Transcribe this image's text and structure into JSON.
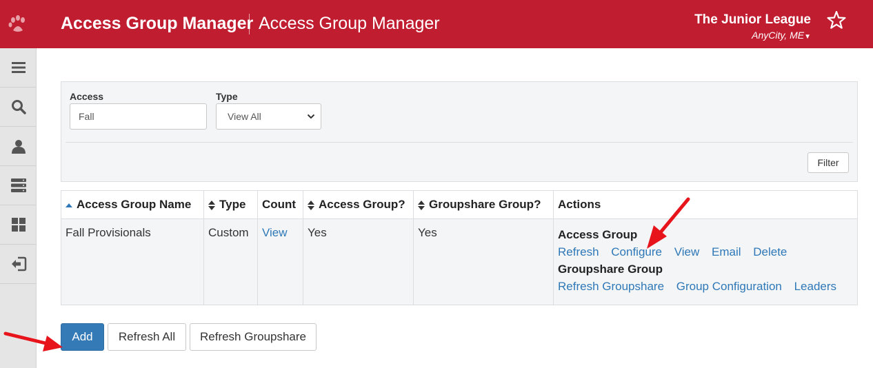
{
  "header": {
    "app_title": "Access Group Manager",
    "page_heading": "Access Group Manager",
    "org_name": "The Junior League",
    "org_location": "AnyCity, ME",
    "logo_icon": "paw-icon",
    "favorite_icon": "star-outline-icon",
    "color": "#c01d30"
  },
  "sidebar": {
    "items": [
      {
        "icon": "menu-icon"
      },
      {
        "icon": "search-icon"
      },
      {
        "icon": "user-icon"
      },
      {
        "icon": "server-icon"
      },
      {
        "icon": "dashboard-icon"
      },
      {
        "icon": "sign-out-icon"
      }
    ]
  },
  "filter": {
    "access_label": "Access",
    "access_value": "Fall",
    "type_label": "Type",
    "type_value": "View All",
    "filter_button": "Filter"
  },
  "table": {
    "headers": {
      "name": "Access Group Name",
      "type": "Type",
      "count": "Count",
      "access_group": "Access Group?",
      "groupshare_group": "Groupshare Group?",
      "actions": "Actions"
    },
    "rows": [
      {
        "name": "Fall Provisionals",
        "type": "Custom",
        "count": "View",
        "access_group": "Yes",
        "groupshare_group": "Yes",
        "actions": {
          "access_heading": "Access Group",
          "access_links": [
            "Refresh",
            "Configure",
            "View",
            "Email",
            "Delete"
          ],
          "groupshare_heading": "Groupshare Group",
          "groupshare_links": [
            "Refresh Groupshare",
            "Group Configuration",
            "Leaders"
          ]
        }
      }
    ]
  },
  "buttons": {
    "add": "Add",
    "refresh_all": "Refresh All",
    "refresh_groupshare": "Refresh Groupshare"
  },
  "colors": {
    "link": "#2e78b7",
    "primary_button": "#337ab7",
    "annotation_arrow": "#e8141c"
  }
}
